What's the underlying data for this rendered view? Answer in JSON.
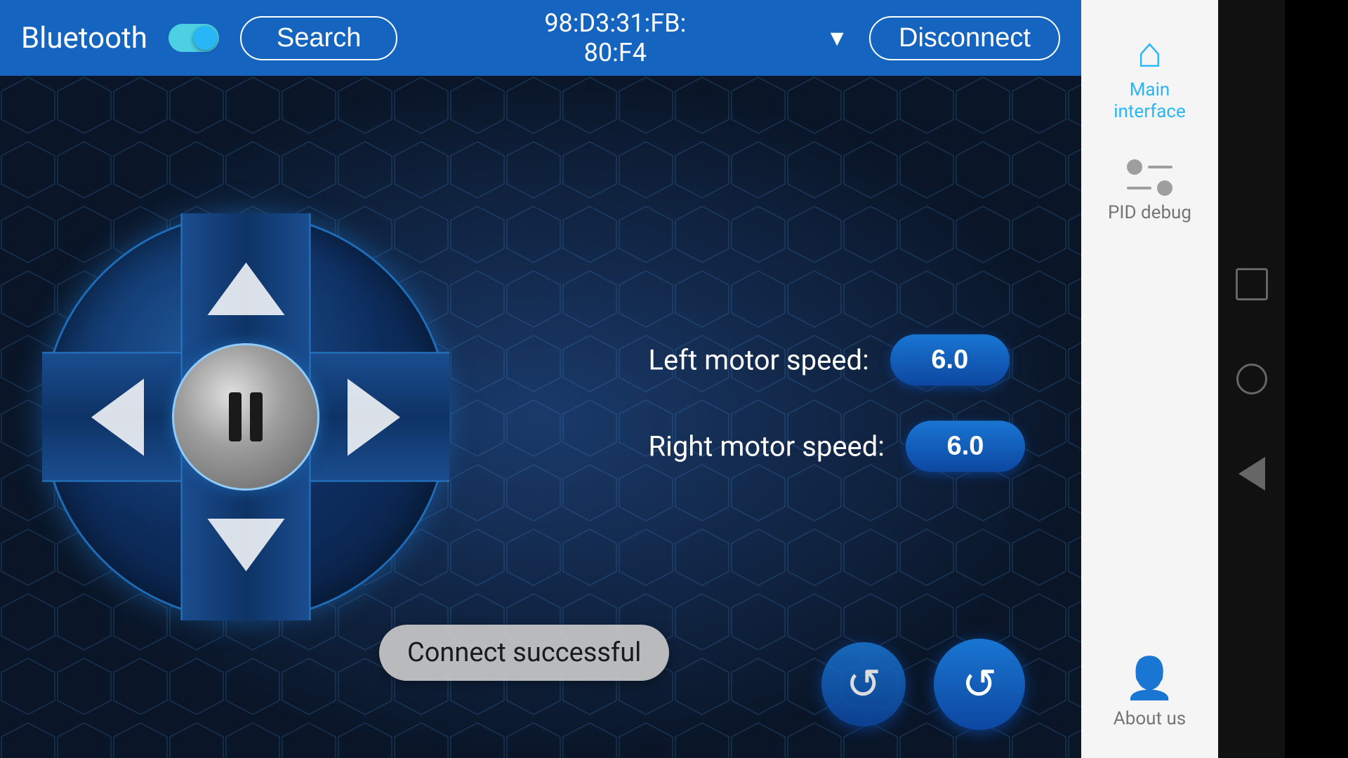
{
  "header": {
    "bluetooth_label": "Bluetooth",
    "search_label": "Search",
    "device_address": "98:D3:31:FB:\n80:F4",
    "disconnect_label": "Disconnect"
  },
  "main": {
    "left_motor": {
      "label": "Left motor speed:",
      "value": "6.0"
    },
    "right_motor": {
      "label": "Right motor speed:",
      "value": "6.0"
    },
    "toast_message": "Connect successful",
    "controls": {
      "up_label": "up",
      "down_label": "down",
      "left_label": "left",
      "right_label": "right",
      "pause_label": "pause"
    }
  },
  "sidebar": {
    "main_interface_label": "Main\ninterface",
    "pid_debug_label": "PID debug",
    "about_us_label": "About us"
  },
  "nav": {
    "square_label": "square-nav",
    "circle_label": "circle-nav",
    "back_label": "back-nav"
  }
}
